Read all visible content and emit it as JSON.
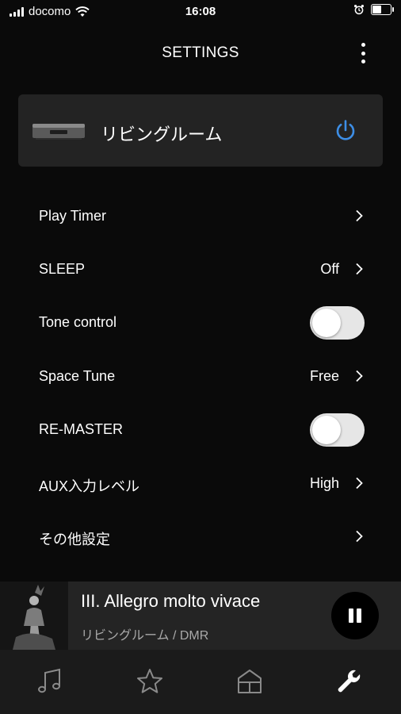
{
  "status_bar": {
    "carrier": "docomo",
    "time": "16:08",
    "icons": [
      "signal-icon",
      "wifi-icon",
      "alarm-icon",
      "battery-icon"
    ]
  },
  "header": {
    "title": "SETTINGS",
    "menu_icon": "more-vertical-icon"
  },
  "device": {
    "name": "リビングルーム",
    "power_icon": "power-icon",
    "power_color": "#3d8ee6"
  },
  "settings": [
    {
      "label": "Play Timer",
      "value": "",
      "control": "chevron"
    },
    {
      "label": "SLEEP",
      "value": "Off",
      "control": "chevron"
    },
    {
      "label": "Tone control",
      "value": "",
      "control": "toggle",
      "on": false
    },
    {
      "label": "Space Tune",
      "value": "Free",
      "control": "chevron"
    },
    {
      "label": "RE-MASTER",
      "value": "",
      "control": "toggle",
      "on": false
    },
    {
      "label": "AUX入力レベル",
      "value": "High",
      "control": "chevron"
    },
    {
      "label": "その他設定",
      "value": "",
      "control": "chevron"
    }
  ],
  "now_playing": {
    "title": "III. Allegro molto vivace",
    "subtitle": "リビングルーム / DMR",
    "state": "playing",
    "control_icon": "pause-icon"
  },
  "tabs": [
    {
      "icon": "music-note-icon",
      "active": false
    },
    {
      "icon": "star-icon",
      "active": false
    },
    {
      "icon": "home-icon",
      "active": false
    },
    {
      "icon": "wrench-icon",
      "active": true
    }
  ],
  "colors": {
    "background": "#0a0a0a",
    "card": "#232323",
    "accent": "#3d8ee6",
    "secondary_text": "#a8a8a8",
    "inactive_icon": "#8a8a8a"
  }
}
